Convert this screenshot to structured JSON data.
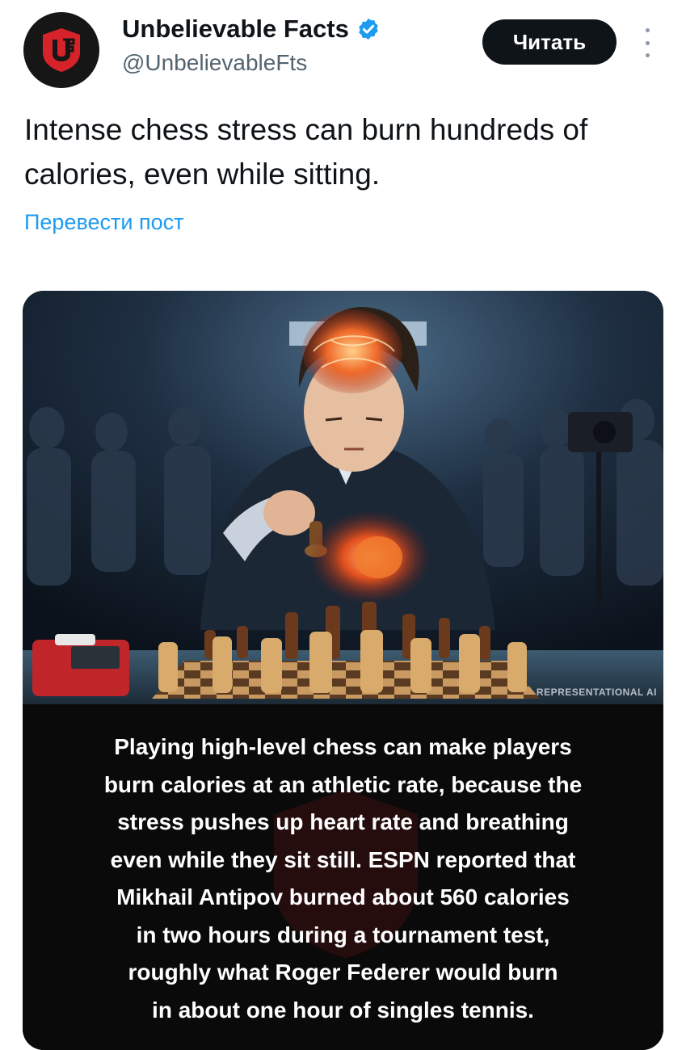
{
  "account": {
    "display_name": "Unbelievable Facts",
    "handle": "@UnbelievableFts",
    "verified": true
  },
  "actions": {
    "read_label": "Читать",
    "more_icon": "more-vertical-icon"
  },
  "post": {
    "text": "Intense chess stress can burn hundreds of calories, even while sitting.",
    "translate_label": "Перевести пост"
  },
  "media": {
    "watermark": "REPRESENTATIONAL AI",
    "caption": "Playing high-level chess can make players\nburn calories at an athletic rate, because the\nstress pushes up heart rate and breathing\neven while they sit still. ESPN reported that\nMikhail Antipov burned about 560 calories\nin two hours during a tournament test,\nroughly what Roger Federer would burn\nin about one hour of singles tennis."
  },
  "colors": {
    "accent": "#1d9bf0",
    "brand_red": "#d6232a",
    "text": "#0f1419",
    "secondary_text": "#536471"
  }
}
